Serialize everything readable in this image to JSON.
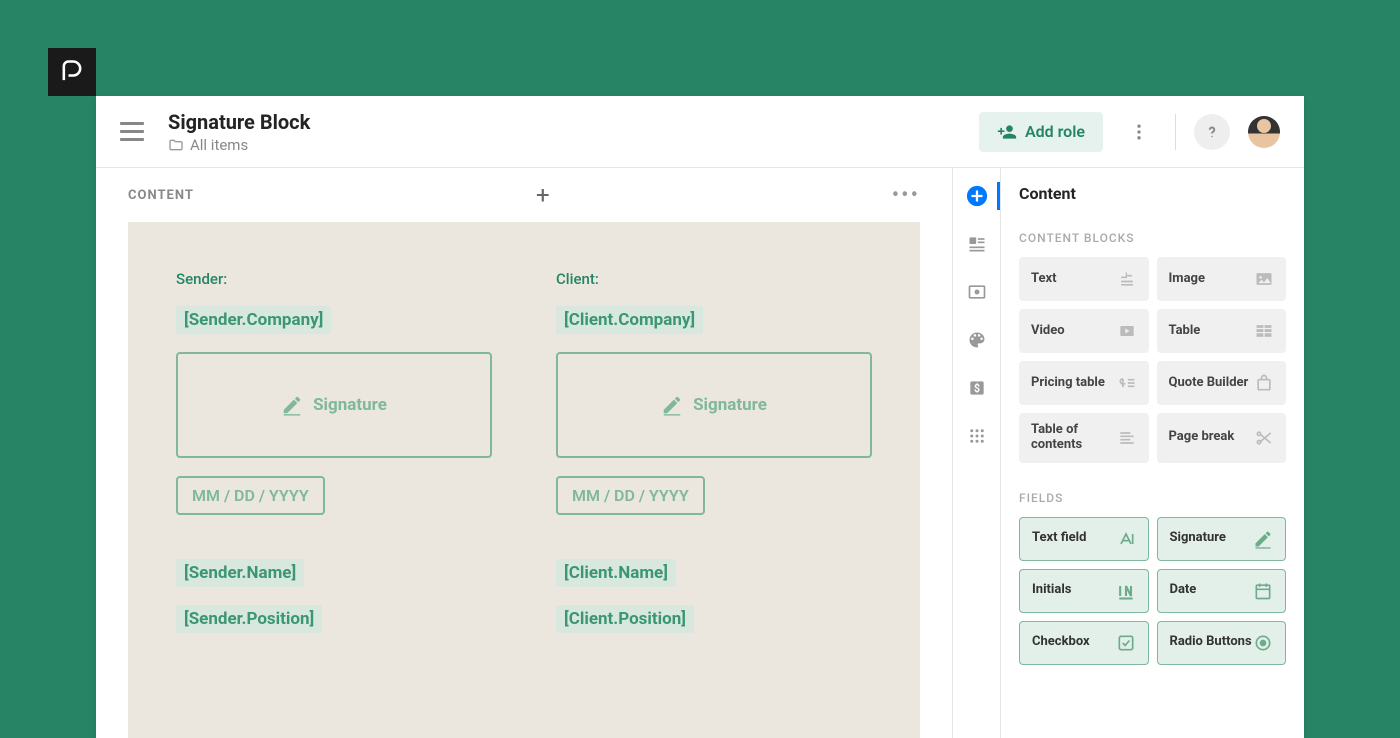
{
  "header": {
    "title": "Signature Block",
    "breadcrumb": "All items",
    "add_role_label": "Add role"
  },
  "canvas": {
    "header_label": "CONTENT",
    "sender": {
      "label": "Sender:",
      "company_token": "[Sender.Company]",
      "signature_label": "Signature",
      "date_placeholder": "MM / DD / YYYY",
      "name_token": "[Sender.Name]",
      "position_token": "[Sender.Position]"
    },
    "client": {
      "label": "Client:",
      "company_token": "[Client.Company]",
      "signature_label": "Signature",
      "date_placeholder": "MM / DD / YYYY",
      "name_token": "[Client.Name]",
      "position_token": "[Client.Position]"
    }
  },
  "panel": {
    "title": "Content",
    "blocks_label": "CONTENT BLOCKS",
    "fields_label": "FIELDS",
    "blocks": {
      "text": "Text",
      "image": "Image",
      "video": "Video",
      "table": "Table",
      "pricing": "Pricing table",
      "quote": "Quote Builder",
      "toc": "Table of contents",
      "pagebreak": "Page break"
    },
    "fields": {
      "textfield": "Text field",
      "signature": "Signature",
      "initials": "Initials",
      "date": "Date",
      "checkbox": "Checkbox",
      "radio": "Radio Buttons"
    }
  }
}
